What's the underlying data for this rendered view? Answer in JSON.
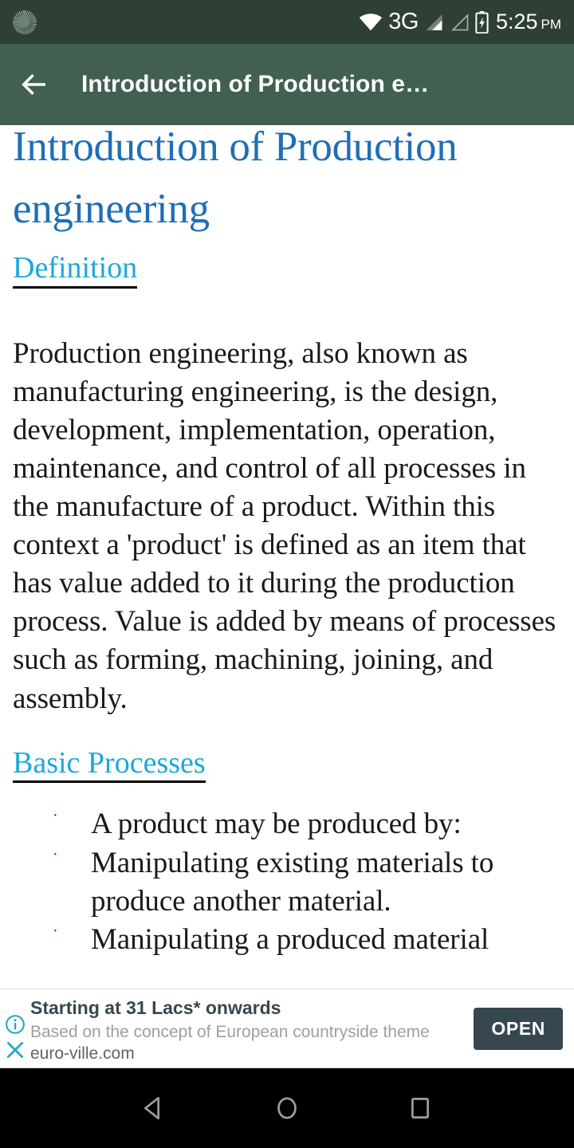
{
  "status_bar": {
    "sync_icon": "sync-circle-icon",
    "wifi_icon": "wifi-icon",
    "network_type": "3G",
    "signal_icon_1": "signal-bars-icon",
    "signal_icon_2": "signal-bars-empty-icon",
    "battery_icon": "battery-charging-icon",
    "time": "5:25",
    "am_pm": "PM",
    "background_color": "#2e4034"
  },
  "app_bar": {
    "back_icon": "back-arrow-icon",
    "title": "Introduction of Production e…",
    "background_color": "#416052"
  },
  "document": {
    "title": "Introduction of Production engineering",
    "title_color": "#1f6fb5",
    "heading_color": "#1ca8dd",
    "sections": [
      {
        "heading": "Definition",
        "paragraph": "Production engineering, also known as manufacturing engineering, is the design, development, implementation, operation, maintenance, and control of all processes in the manufacture of a product. Within this context a 'product' is defined as an item that has value added to it during the production process. Value is added by means of processes such as forming, machining, joining, and assembly."
      },
      {
        "heading": "Basic Processes",
        "bullets": [
          "A product may be produced by:",
          "Manipulating existing materials to produce another material.",
          "Manipulating a produced material"
        ],
        "bullet_marker": "·",
        "bullet_color": "#cc0000"
      }
    ]
  },
  "ad": {
    "info_icon": "info-icon",
    "close_icon": "close-icon",
    "headline": "Starting at 31 Lacs* onwards",
    "description": "Based on the concept of European countryside theme ",
    "domain": "euro-ville.com",
    "cta_label": "OPEN",
    "cta_color": "#37474f",
    "icon_color": "#2ba8c8"
  },
  "nav_bar": {
    "back_icon": "nav-back-triangle-icon",
    "home_icon": "nav-home-circle-icon",
    "recents_icon": "nav-recents-square-icon",
    "background_color": "#000000"
  }
}
